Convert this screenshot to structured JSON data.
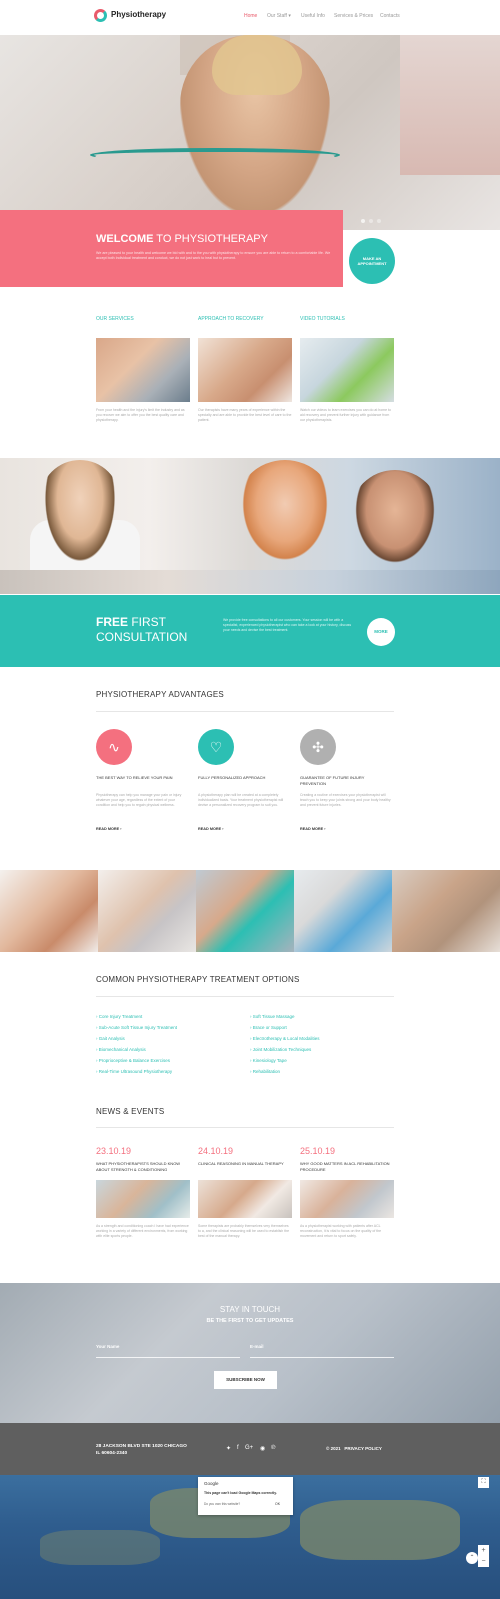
{
  "header": {
    "logo": "Physiotherapy",
    "nav": [
      "Home",
      "Our Staff",
      "Useful Info",
      "Services & Prices",
      "Contacts"
    ],
    "nav_caret": "▾"
  },
  "hero": {
    "title_bold": "WELCOME",
    "title_rest": " TO PHYSIOTHERAPY",
    "text": "We are pleased to your health and welcome we bid with and to the you with physiotherapy to ensure you are able to return to a comfortable life. We accept both Individual treatment and conduct, we do not just work to heal but to prevent.",
    "appointment": "MAKE AN APPOINTMENT"
  },
  "services": [
    {
      "title": "OUR SERVICES",
      "text": "From your health and the injury's limit the industry and as you recover we aim to offer you the best quality care and physiotherapy."
    },
    {
      "title": "APPROACH TO RECOVERY",
      "text": "Our therapists have many years of experience within the specialty and are able to provide the best level of care to the patient."
    },
    {
      "title": "VIDEO TUTORIALS",
      "text": "Watch our videos to learn exercises you can do at home to aid recovery and prevent further injury with guidance from our physiotherapists."
    }
  ],
  "consult": {
    "title_bold": "FREE",
    "title_rest1": " FIRST",
    "title_line2": "CONSULTATION",
    "text": "We provide free consultations to all our customers. Your session will be with a specialist, experienced physiotherapist who can take a look at your history, discuss your needs and devise the best treatment.",
    "more": "MORE"
  },
  "advantages": {
    "title": "PHYSIOTHERAPY ADVANTAGES",
    "items": [
      {
        "icon": "pulse-icon",
        "glyph": "∿",
        "color": "#f4707f",
        "title": "THE BEST WAY TO RELIEVE YOUR PAIN",
        "text": "Physiotherapy can help you manage your pain or injury whatever your age, regardless of the extent of your condition and help you to regain physical wellness.",
        "read": "READ MORE"
      },
      {
        "icon": "heart-icon",
        "glyph": "♡",
        "color": "#2cbfb3",
        "title": "FULLY PERSONALIZED APPROACH",
        "text": "A physiotherapy plan will be created at a completely individualized basis. Your treatment physiotherapist will devise a personalized recovery program to suit you.",
        "read": "READ MORE"
      },
      {
        "icon": "cross-icon",
        "glyph": "✣",
        "color": "#b0b0b0",
        "title": "GUARANTEE OF FUTURE INJURY PREVENTION",
        "text": "Creating a routine of exercises your physiotherapist will teach you to keep your joints strong and your body healthy and prevent future injuries.",
        "read": "READ MORE"
      }
    ]
  },
  "treatments": {
    "title": "COMMON PHYSIOTHERAPY TREATMENT OPTIONS",
    "left": [
      "Core Injury Treatment",
      "Sub-Acute Soft Tissue Injury Treatment",
      "Gait Analysis",
      "Biomechanical Analysis",
      "Proprioceptive & Balance Exercises",
      "Real-Time Ultrasound Physiotherapy"
    ],
    "right": [
      "Soft Tissue Massage",
      "Brace or Support",
      "Electrotherapy & Local Modalities",
      "Joint Mobilization Techniques",
      "Kinesiology Tape",
      "Rehabilitation"
    ]
  },
  "news": {
    "title": "NEWS & EVENTS",
    "items": [
      {
        "date": "23.10.19",
        "title": "WHAT PHYSIOTHERAPISTS SHOULD KNOW ABOUT STRENGTH & CONDITIONING",
        "text": "As a strength and conditioning coach I have had experience working in a variety of different environments, from working with elite sports people."
      },
      {
        "date": "24.10.19",
        "title": "CLINICAL REASONING IN MANUAL THERAPY",
        "text": "Some therapists are probably themselves very themselves to a, and the clinical reasoning will be used to establish the best of the manual therapy."
      },
      {
        "date": "25.10.19",
        "title": "WHY GOOD MATTERS IN ACL REHABILITATION PROCEDURE",
        "text": "As a physiotherapist working with patients after ACL reconstruction, it is vital to focus on the quality of the movement and return to sport safely."
      }
    ]
  },
  "subscribe": {
    "title": "STAY IN TOUCH",
    "subtitle": "BE THE FIRST TO GET UPDATES",
    "name_label": "Your Name",
    "email_label": "E-mail",
    "button": "SUBSCRIBE NOW"
  },
  "footer": {
    "address1": "28 JACKSON BLVD STE 1020 CHICAGO",
    "address2": "IL 60604-2340",
    "social": [
      "twitter-icon",
      "facebook-icon",
      "google-plus-icon",
      "rss-icon",
      "pinterest-icon"
    ],
    "social_glyphs": [
      "🐦",
      "f",
      "G+",
      "◉",
      "℗"
    ],
    "copyright": "© 2021",
    "privacy": "PRIVACY POLICY"
  },
  "map": {
    "popup_title": "Google",
    "popup_msg": "This page can't load Google Maps correctly.",
    "popup_own": "Do you own this website?",
    "popup_ok": "OK"
  }
}
